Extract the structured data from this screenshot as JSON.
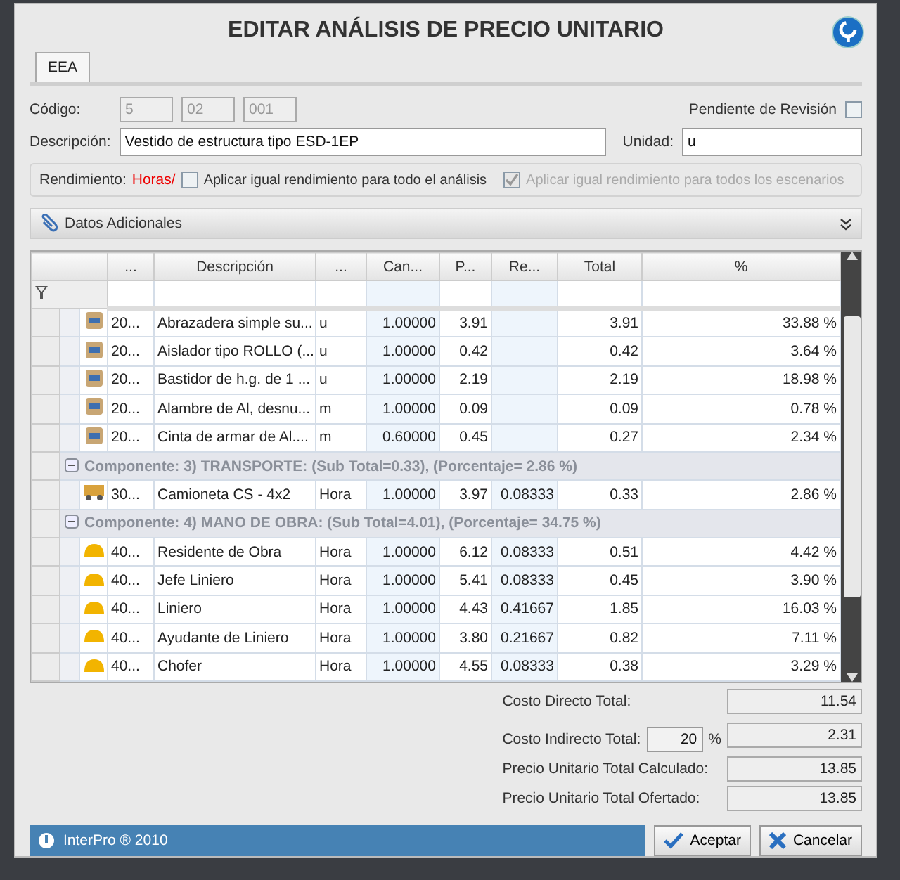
{
  "window": {
    "title": "EDITAR ANÁLISIS DE PRECIO UNITARIO"
  },
  "tabs": [
    {
      "label": "EEA",
      "selected": true
    }
  ],
  "form": {
    "codigo_label": "Código:",
    "codigo": [
      "5",
      "02",
      "001"
    ],
    "pendiente": {
      "label": "Pendiente de Revisión",
      "checked": false
    },
    "descripcion_label": "Descripción:",
    "descripcion": "Vestido de estructura tipo ESD-1EP",
    "unidad_label": "Unidad:",
    "unidad": "u",
    "rendimiento_label": "Rendimiento:",
    "rendimiento_value": "Horas/",
    "options": [
      {
        "label": "Aplicar igual rendimiento para todo el análisis",
        "checked": false,
        "disabled": false
      },
      {
        "label": "Aplicar igual rendimiento para todos los escenarios",
        "checked": true,
        "disabled": true
      }
    ]
  },
  "section": {
    "label": "Datos Adicionales",
    "expanded": false
  },
  "table": {
    "columns": [
      "...",
      "Descripción",
      "...",
      "Can...",
      "P...",
      "Re...",
      "Total",
      "%"
    ],
    "rows": [
      {
        "kind": "material",
        "cells": [
          "20...",
          "Abrazadera simple su...",
          "u",
          "1.00000",
          "3.91",
          "",
          "3.91",
          "33.88 %"
        ]
      },
      {
        "kind": "material",
        "cells": [
          "20...",
          "Aislador tipo ROLLO (...",
          "u",
          "1.00000",
          "0.42",
          "",
          "0.42",
          "3.64 %"
        ]
      },
      {
        "kind": "material",
        "cells": [
          "20...",
          "Bastidor de h.g. de 1 ...",
          "u",
          "1.00000",
          "2.19",
          "",
          "2.19",
          "18.98 %"
        ]
      },
      {
        "kind": "material",
        "cells": [
          "20...",
          "Alambre de Al, desnu...",
          "m",
          "1.00000",
          "0.09",
          "",
          "0.09",
          "0.78 %"
        ]
      },
      {
        "kind": "material",
        "cells": [
          "20...",
          "Cinta de armar de Al....",
          "m",
          "0.60000",
          "0.45",
          "",
          "0.27",
          "2.34 %"
        ]
      },
      {
        "kind": "group",
        "expanded": true,
        "label": "Componente: 3) TRANSPORTE: (Sub Total=0.33), (Porcentaje= 2.86 %)"
      },
      {
        "kind": "vehicle",
        "cells": [
          "30...",
          "Camioneta CS - 4x2",
          "Hora",
          "1.00000",
          "3.97",
          "0.08333",
          "0.33",
          "2.86 %"
        ]
      },
      {
        "kind": "group",
        "expanded": true,
        "label": "Componente: 4) MANO DE OBRA: (Sub Total=4.01), (Porcentaje= 34.75 %)"
      },
      {
        "kind": "worker",
        "cells": [
          "40...",
          "Residente de Obra",
          "Hora",
          "1.00000",
          "6.12",
          "0.08333",
          "0.51",
          "4.42 %"
        ]
      },
      {
        "kind": "worker",
        "cells": [
          "40...",
          "Jefe Liniero",
          "Hora",
          "1.00000",
          "5.41",
          "0.08333",
          "0.45",
          "3.90 %"
        ]
      },
      {
        "kind": "worker",
        "cells": [
          "40...",
          "Liniero",
          "Hora",
          "1.00000",
          "4.43",
          "0.41667",
          "1.85",
          "16.03 %"
        ]
      },
      {
        "kind": "worker",
        "cells": [
          "40...",
          "Ayudante de Liniero",
          "Hora",
          "1.00000",
          "3.80",
          "0.21667",
          "0.82",
          "7.11 %"
        ]
      },
      {
        "kind": "worker",
        "cells": [
          "40...",
          "Chofer",
          "Hora",
          "1.00000",
          "4.55",
          "0.08333",
          "0.38",
          "3.29 %"
        ]
      }
    ]
  },
  "totals": {
    "directo_label": "Costo Directo Total:",
    "directo": "11.54",
    "indirecto_label": "Costo Indirecto Total:",
    "indirecto_pct": "20",
    "pct_sign": "%",
    "indirecto": "2.31",
    "calculado_label": "Precio Unitario Total Calculado:",
    "calculado": "13.85",
    "ofertado_label": "Precio Unitario Total Ofertado:",
    "ofertado": "13.85"
  },
  "status_bar": {
    "text": "InterPro ® 2010"
  },
  "buttons": [
    {
      "kind": "accept",
      "label": "Aceptar"
    },
    {
      "kind": "cancel",
      "label": "Cancelar"
    }
  ]
}
